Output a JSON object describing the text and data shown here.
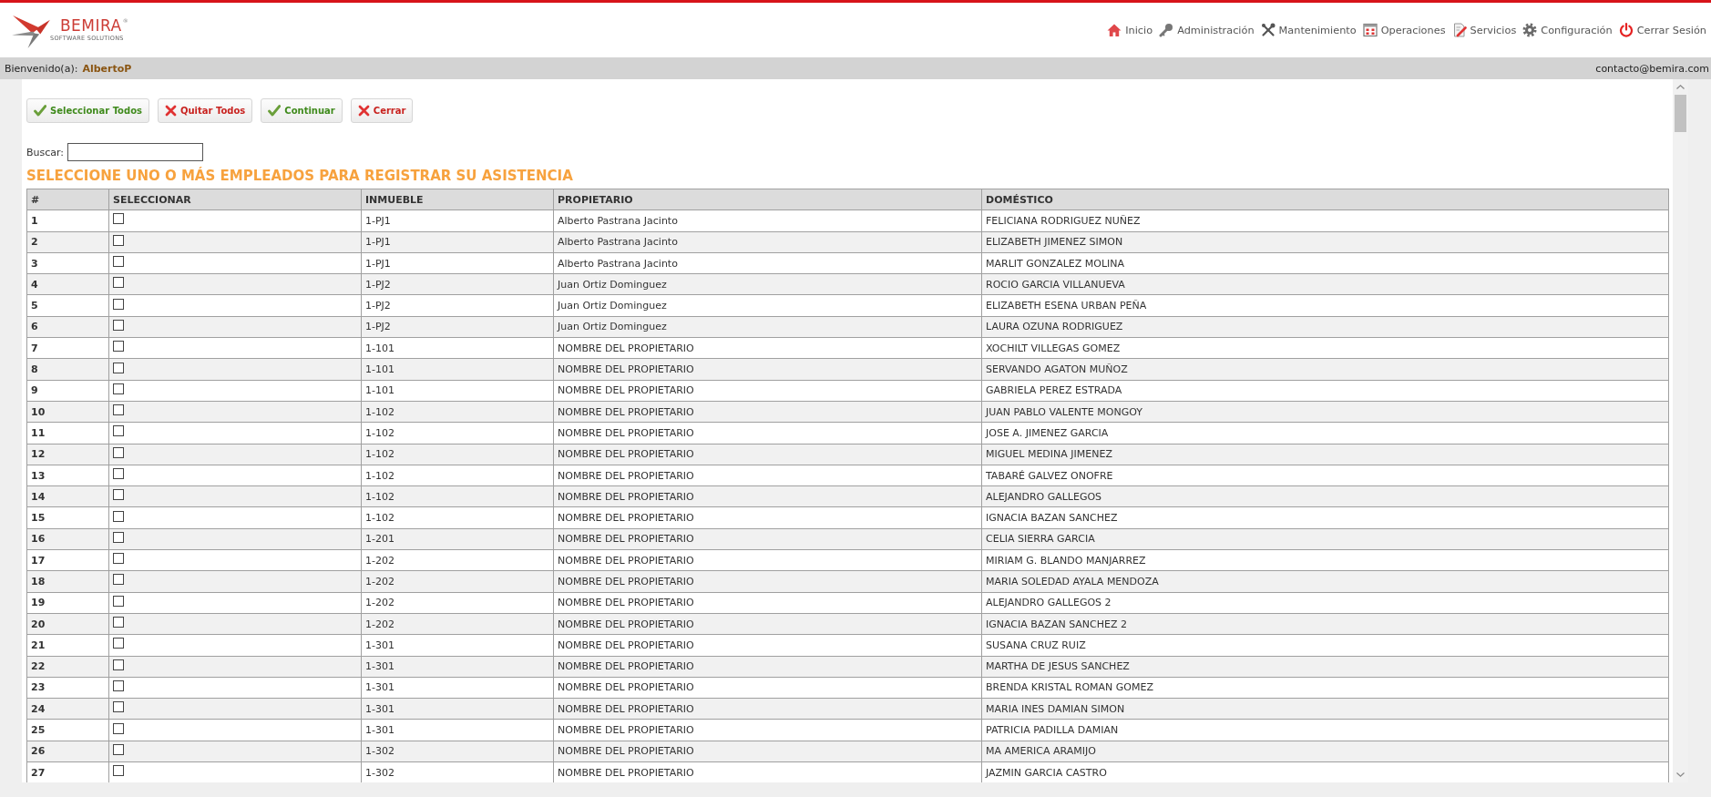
{
  "header": {
    "logo": {
      "name": "BEMIRA",
      "trademark": "®",
      "tagline": "SOFTWARE SOLUTIONS"
    },
    "nav": [
      "Inicio",
      "Administración",
      "Mantenimiento",
      "Operaciones",
      "Servicios",
      "Configuración",
      "Cerrar Sesión"
    ]
  },
  "welcome_bar": {
    "greeting": "Bienvenido(a):",
    "user": "AlbertoP",
    "email": "contacto@bemira.com"
  },
  "toolbar": [
    {
      "label": "Seleccionar Todos",
      "kind": "confirm"
    },
    {
      "label": "Quitar Todos",
      "kind": "cancel"
    },
    {
      "label": "Continuar",
      "kind": "confirm"
    },
    {
      "label": "Cerrar",
      "kind": "cancel"
    }
  ],
  "search": {
    "label": "Buscar:"
  },
  "title": "SELECCIONE UNO O MÁS EMPLEADOS PARA REGISTRAR SU ASISTENCIA",
  "table": {
    "columns": [
      "#",
      "SELECCIONAR",
      "INMUEBLE",
      "PROPIETARIO",
      "DOMÉSTICO"
    ],
    "rows": [
      {
        "number": "1",
        "checked": false,
        "property": "1-PJ1",
        "owner": "Alberto Pastrana Jacinto",
        "domestic": "FELICIANA RODRIGUEZ NUÑEZ"
      },
      {
        "number": "2",
        "checked": false,
        "property": "1-PJ1",
        "owner": "Alberto Pastrana Jacinto",
        "domestic": "ELIZABETH JIMENEZ SIMON"
      },
      {
        "number": "3",
        "checked": false,
        "property": "1-PJ1",
        "owner": "Alberto Pastrana Jacinto",
        "domestic": "MARLIT GONZALEZ MOLINA"
      },
      {
        "number": "4",
        "checked": false,
        "property": "1-PJ2",
        "owner": "Juan Ortiz Dominguez",
        "domestic": "ROCIO GARCIA VILLANUEVA"
      },
      {
        "number": "5",
        "checked": false,
        "property": "1-PJ2",
        "owner": "Juan Ortiz Dominguez",
        "domestic": "ELIZABETH ESENA URBAN PEÑA"
      },
      {
        "number": "6",
        "checked": false,
        "property": "1-PJ2",
        "owner": "Juan Ortiz Dominguez",
        "domestic": "LAURA OZUNA RODRIGUEZ"
      },
      {
        "number": "7",
        "checked": false,
        "property": "1-101",
        "owner": "NOMBRE DEL PROPIETARIO",
        "domestic": "XOCHILT VILLEGAS GOMEZ"
      },
      {
        "number": "8",
        "checked": false,
        "property": "1-101",
        "owner": "NOMBRE DEL PROPIETARIO",
        "domestic": "SERVANDO AGATON MUÑOZ"
      },
      {
        "number": "9",
        "checked": false,
        "property": "1-101",
        "owner": "NOMBRE DEL PROPIETARIO",
        "domestic": "GABRIELA PEREZ ESTRADA"
      },
      {
        "number": "10",
        "checked": false,
        "property": "1-102",
        "owner": "NOMBRE DEL PROPIETARIO",
        "domestic": "JUAN PABLO VALENTE MONGOY"
      },
      {
        "number": "11",
        "checked": false,
        "property": "1-102",
        "owner": "NOMBRE DEL PROPIETARIO",
        "domestic": "JOSE A. JIMENEZ GARCIA"
      },
      {
        "number": "12",
        "checked": false,
        "property": "1-102",
        "owner": "NOMBRE DEL PROPIETARIO",
        "domestic": "MIGUEL MEDINA JIMENEZ"
      },
      {
        "number": "13",
        "checked": false,
        "property": "1-102",
        "owner": "NOMBRE DEL PROPIETARIO",
        "domestic": "TABARÉ GALVEZ ONOFRE"
      },
      {
        "number": "14",
        "checked": false,
        "property": "1-102",
        "owner": "NOMBRE DEL PROPIETARIO",
        "domestic": "ALEJANDRO GALLEGOS"
      },
      {
        "number": "15",
        "checked": false,
        "property": "1-102",
        "owner": "NOMBRE DEL PROPIETARIO",
        "domestic": "IGNACIA BAZAN SANCHEZ"
      },
      {
        "number": "16",
        "checked": false,
        "property": "1-201",
        "owner": "NOMBRE DEL PROPIETARIO",
        "domestic": "CELIA SIERRA GARCIA"
      },
      {
        "number": "17",
        "checked": false,
        "property": "1-202",
        "owner": "NOMBRE DEL PROPIETARIO",
        "domestic": "MIRIAM G. BLANDO MANJARREZ"
      },
      {
        "number": "18",
        "checked": false,
        "property": "1-202",
        "owner": "NOMBRE DEL PROPIETARIO",
        "domestic": "MARIA SOLEDAD AYALA MENDOZA"
      },
      {
        "number": "19",
        "checked": false,
        "property": "1-202",
        "owner": "NOMBRE DEL PROPIETARIO",
        "domestic": "ALEJANDRO GALLEGOS 2"
      },
      {
        "number": "20",
        "checked": false,
        "property": "1-202",
        "owner": "NOMBRE DEL PROPIETARIO",
        "domestic": "IGNACIA BAZAN SANCHEZ 2"
      },
      {
        "number": "21",
        "checked": false,
        "property": "1-301",
        "owner": "NOMBRE DEL PROPIETARIO",
        "domestic": "SUSANA CRUZ RUIZ"
      },
      {
        "number": "22",
        "checked": false,
        "property": "1-301",
        "owner": "NOMBRE DEL PROPIETARIO",
        "domestic": "MARTHA DE JESUS SANCHEZ"
      },
      {
        "number": "23",
        "checked": false,
        "property": "1-301",
        "owner": "NOMBRE DEL PROPIETARIO",
        "domestic": "BRENDA KRISTAL ROMAN GOMEZ"
      },
      {
        "number": "24",
        "checked": false,
        "property": "1-301",
        "owner": "NOMBRE DEL PROPIETARIO",
        "domestic": "MARIA INES DAMIAN SIMON"
      },
      {
        "number": "25",
        "checked": false,
        "property": "1-301",
        "owner": "NOMBRE DEL PROPIETARIO",
        "domestic": "PATRICIA PADILLA DAMIAN"
      },
      {
        "number": "26",
        "checked": false,
        "property": "1-302",
        "owner": "NOMBRE DEL PROPIETARIO",
        "domestic": "MA AMERICA ARAMIJO"
      },
      {
        "number": "27",
        "checked": false,
        "property": "1-302",
        "owner": "NOMBRE DEL PROPIETARIO",
        "domestic": "JAZMIN GARCIA CASTRO"
      }
    ]
  }
}
